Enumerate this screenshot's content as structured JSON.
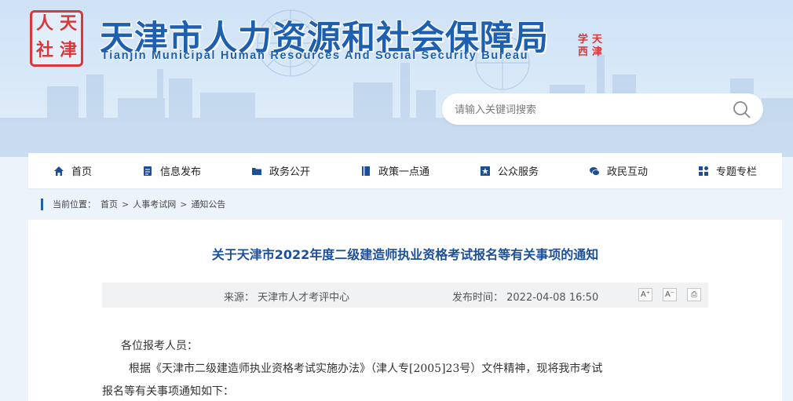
{
  "header": {
    "title": "天津市人力资源和社会保障局",
    "subtitle": "Tianjin Municipal Human Resources And Social Security Bureau",
    "logo_left_chars": [
      "人",
      "天",
      "社",
      "津"
    ],
    "logo_right_chars": [
      "天",
      "津"
    ]
  },
  "search": {
    "placeholder": "请输入关键词搜索"
  },
  "nav": {
    "items": [
      {
        "label": "首页",
        "icon": "home-icon"
      },
      {
        "label": "信息发布",
        "icon": "document-icon"
      },
      {
        "label": "政务公开",
        "icon": "folder-icon"
      },
      {
        "label": "政策一点通",
        "icon": "book-icon"
      },
      {
        "label": "公众服务",
        "icon": "star-icon"
      },
      {
        "label": "政民互动",
        "icon": "chat-icon"
      },
      {
        "label": "专题专栏",
        "icon": "grid-icon"
      }
    ]
  },
  "breadcrumb": {
    "prefix": "当前位置：",
    "items": [
      "首页",
      "人事考试网",
      "通知公告"
    ],
    "separator": ">"
  },
  "article": {
    "title": "关于天津市2022年度二级建造师执业资格考试报名等有关事项的通知",
    "source": "来源：  天津市人才考评中心",
    "publish_time": "发布时间：  2022-04-08 16:50",
    "tools": {
      "font_increase": "A⁺",
      "font_decrease": "A⁻",
      "print": "⎙"
    },
    "greeting": "各位报考人员：",
    "paragraph_1": "根据《天津市二级建造师执业资格考试实施办法》（津人专[2005]23号）文件精神，现将我市考试",
    "paragraph_2": "报名等有关事项通知如下："
  },
  "colors": {
    "brand_blue": "#1d5fb0",
    "title_blue": "#1d4f96",
    "seal_red": "#d7383a",
    "page_bg": "#edf3fb"
  }
}
